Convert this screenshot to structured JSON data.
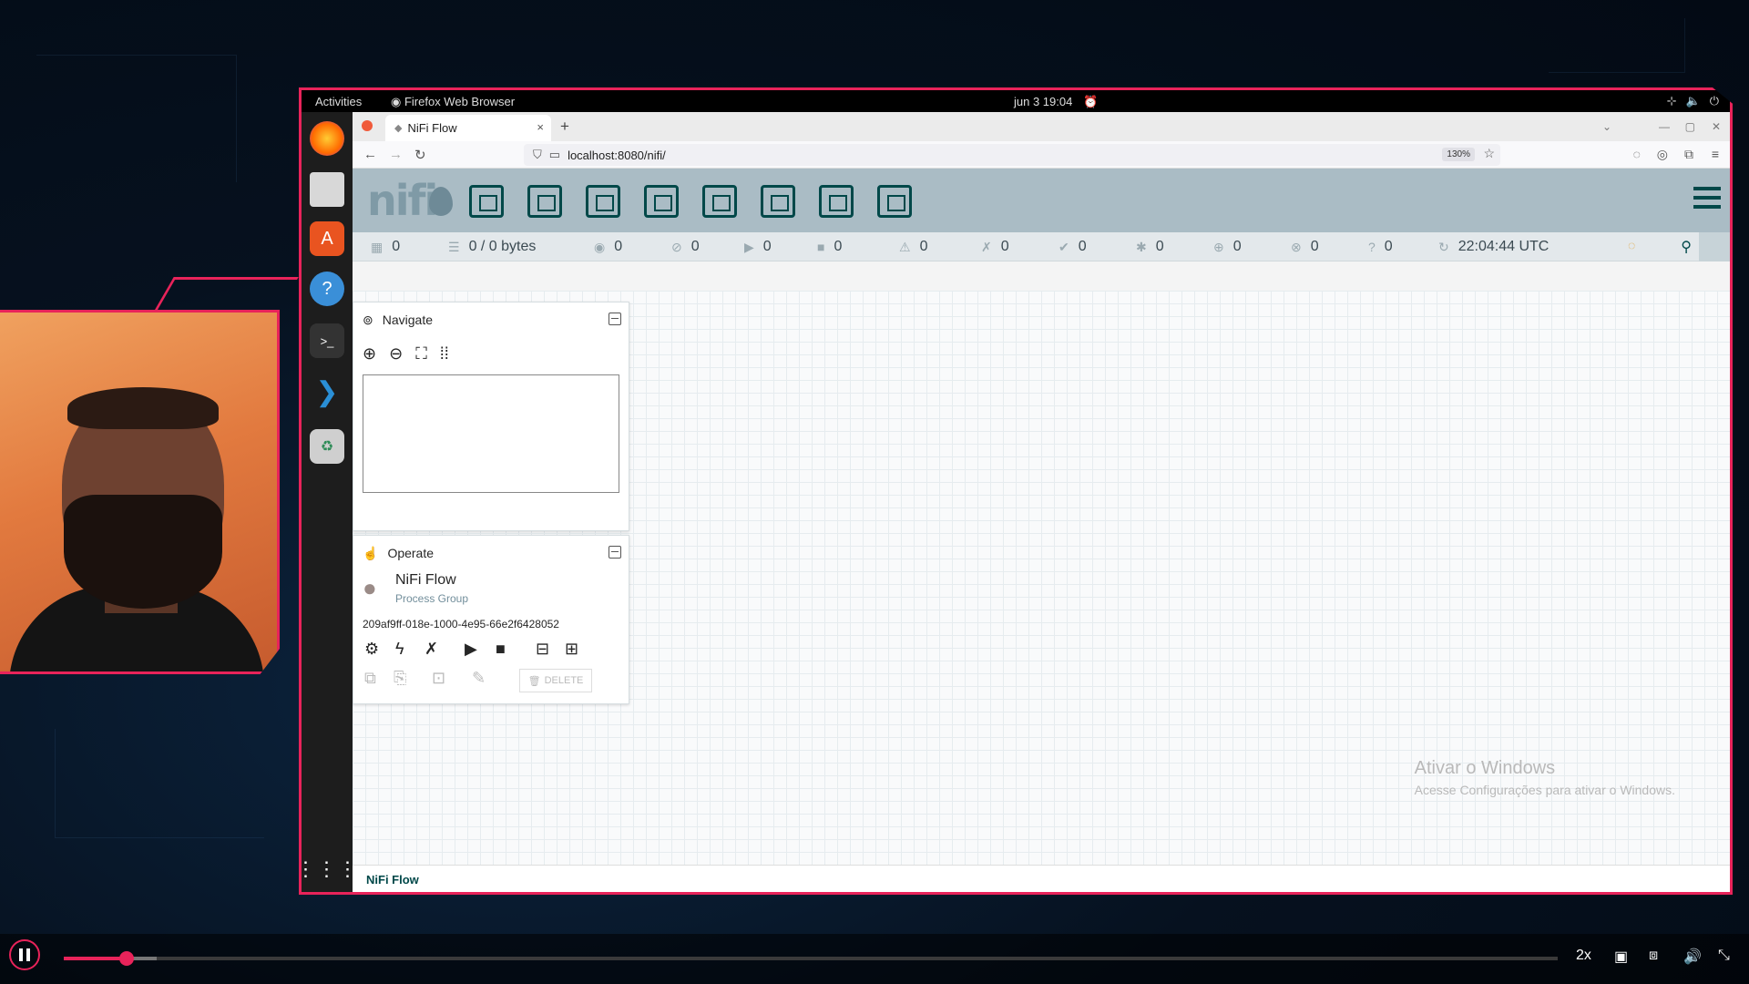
{
  "topbar": {
    "activities": "Activities",
    "app_name": "Firefox Web Browser",
    "datetime": "jun 3  19:04"
  },
  "browser": {
    "tab_title": "NiFi Flow",
    "new_tab": "+",
    "tab_close": "×",
    "url": "localhost:8080/nifi/",
    "zoom": "130%"
  },
  "nifi": {
    "logo": "nifi",
    "status": [
      {
        "icon": "cluster-icon",
        "value": "0"
      },
      {
        "icon": "queue-icon",
        "value": "0 / 0 bytes"
      },
      {
        "icon": "transmitting-icon",
        "value": "0"
      },
      {
        "icon": "not-transmitting-icon",
        "value": "0"
      },
      {
        "icon": "running-icon",
        "value": "0"
      },
      {
        "icon": "stopped-icon",
        "value": "0"
      },
      {
        "icon": "invalid-icon",
        "value": "0"
      },
      {
        "icon": "disabled-icon",
        "value": "0"
      },
      {
        "icon": "up-to-date-icon",
        "value": "0"
      },
      {
        "icon": "locally-modified-icon",
        "value": "0"
      },
      {
        "icon": "stale-icon",
        "value": "0"
      },
      {
        "icon": "modified-stale-icon",
        "value": "0"
      },
      {
        "icon": "sync-failure-icon",
        "value": "0"
      },
      {
        "icon": "refresh-icon",
        "value": "22:04:44 UTC"
      }
    ],
    "navigate": {
      "title": "Navigate"
    },
    "operate": {
      "title": "Operate",
      "name": "NiFi Flow",
      "type": "Process Group",
      "id": "209af9ff-018e-1000-4e95-66e2f6428052",
      "delete_label": "DELETE"
    },
    "breadcrumb": "NiFi Flow"
  },
  "watermark": {
    "line1": "Ativar o Windows",
    "line2": "Acesse Configurações para ativar o Windows."
  },
  "player": {
    "speed": "2x",
    "progress": 0.042,
    "buffered": 0.062
  },
  "colors": {
    "accent": "#e8235a",
    "nifi_header": "#aabcc5",
    "nifi_dark": "#004849"
  }
}
